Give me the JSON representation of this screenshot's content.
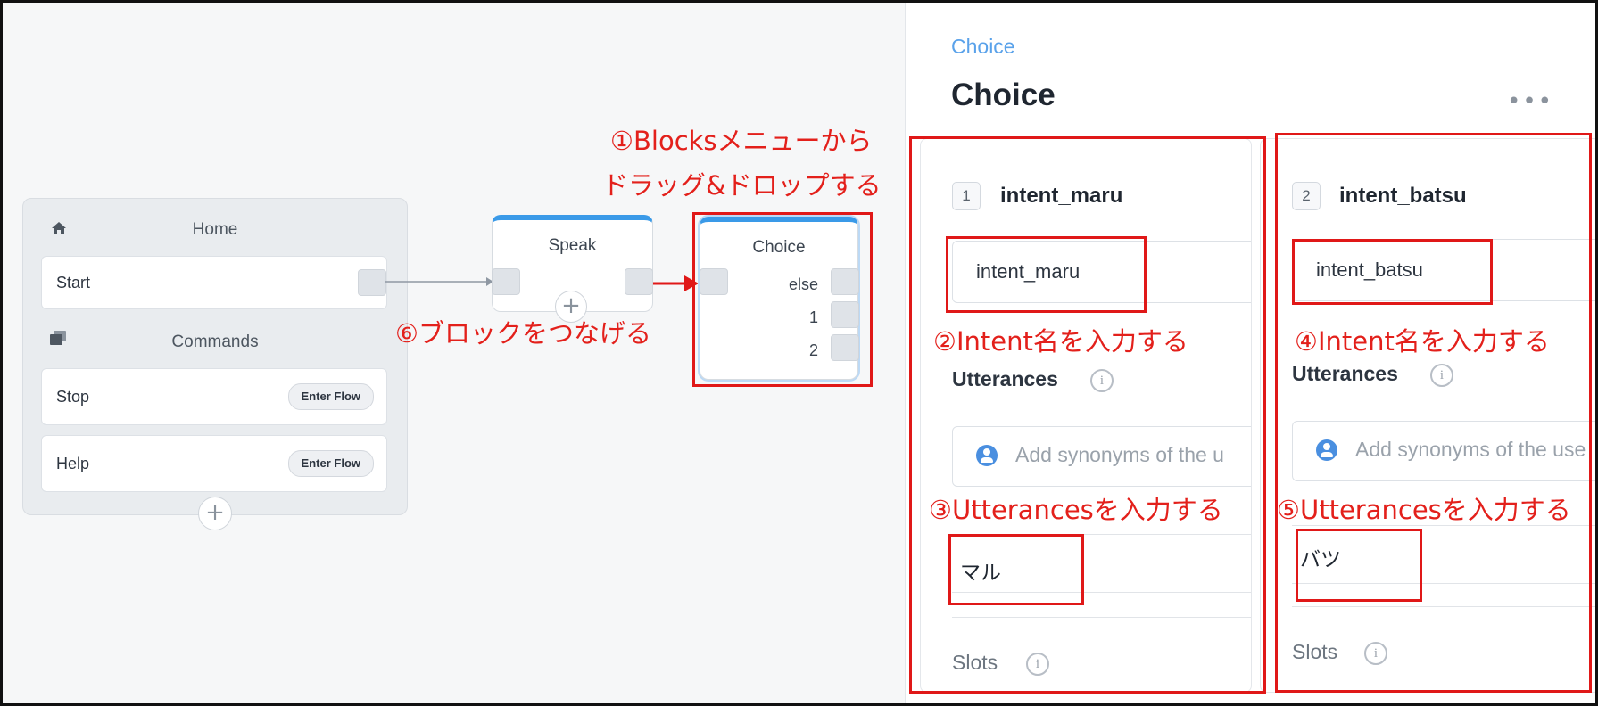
{
  "canvas": {
    "home_block": {
      "title": "Home",
      "start_label": "Start",
      "commands_title": "Commands",
      "commands": [
        {
          "label": "Stop",
          "button": "Enter Flow"
        },
        {
          "label": "Help",
          "button": "Enter Flow"
        }
      ],
      "add_symbol": "+"
    },
    "speak_block": {
      "title": "Speak",
      "add_symbol": "+"
    },
    "choice_block": {
      "title": "Choice",
      "options": [
        "else",
        "1",
        "2"
      ]
    }
  },
  "annotations": {
    "a1_line1": "①Blocksメニューから",
    "a1_line2": "ドラッグ&ドロップする",
    "a2": "②Intent名を入力する",
    "a3": "③Utterancesを入力する",
    "a4": "④Intent名を入力する",
    "a5": "⑤Utterancesを入力する",
    "a6": "⑥ブロックをつなげる",
    "color": "#e3201b"
  },
  "panel": {
    "breadcrumb": "Choice",
    "title": "Choice",
    "more": "•••",
    "intents": [
      {
        "number": "1",
        "name": "intent_maru",
        "input_value": "intent_maru",
        "utterances_label": "Utterances",
        "utterance_placeholder": "Add synonyms of the u",
        "utterance_value": "マル",
        "slots_label": "Slots"
      },
      {
        "number": "2",
        "name": "intent_batsu",
        "input_value": "intent_batsu",
        "utterances_label": "Utterances",
        "utterance_placeholder": "Add synonyms of the use",
        "utterance_value": "バツ",
        "slots_label": "Slots"
      }
    ],
    "info_symbol": "i"
  },
  "colors": {
    "accent": "#3a9ae8",
    "breadcrumb": "#5aa2ea",
    "highlight": "#e01818"
  }
}
